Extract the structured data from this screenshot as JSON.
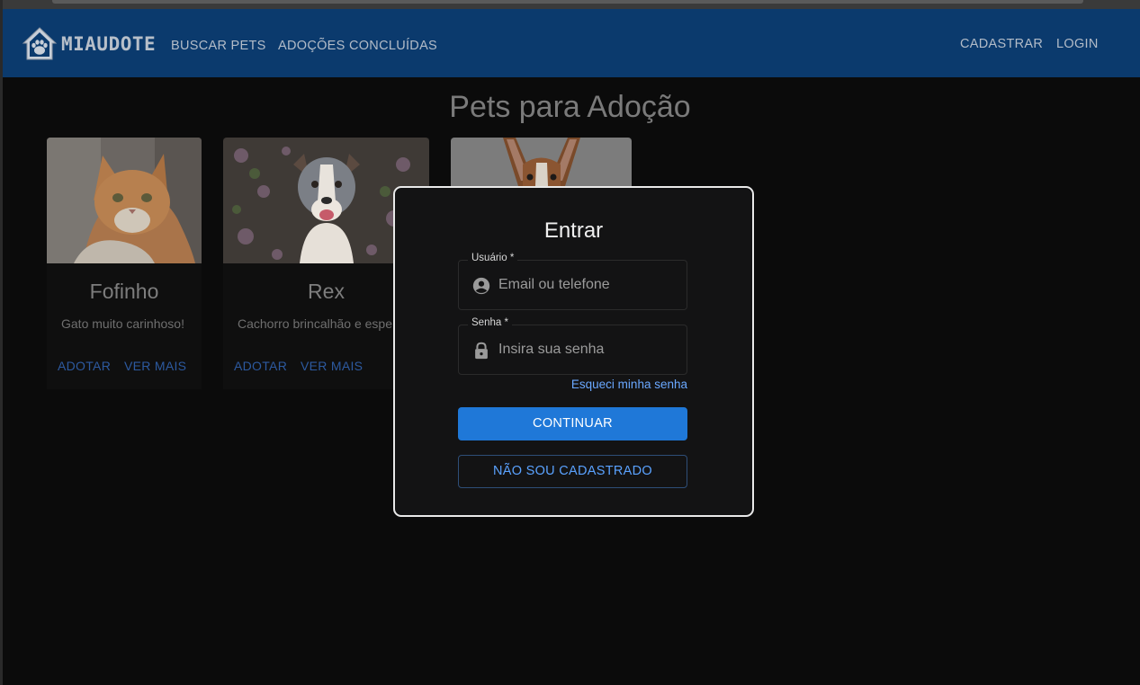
{
  "app": {
    "brand": "MIAUDOTE",
    "nav_left": [
      "BUSCAR PETS",
      "ADOÇÕES CONCLUÍDAS"
    ],
    "nav_right": [
      "CADASTRAR",
      "LOGIN"
    ]
  },
  "page": {
    "title": "Pets para Adoção"
  },
  "pets": [
    {
      "name": "Fofinho",
      "description": "Gato muito carinhoso!",
      "adopt_label": "ADOTAR",
      "more_label": "VER MAIS"
    },
    {
      "name": "Rex",
      "description": "Cachorro brincalhão e espe",
      "adopt_label": "ADOTAR",
      "more_label": "VER MAIS"
    }
  ],
  "login_modal": {
    "title": "Entrar",
    "username_label": "Usuário *",
    "username_placeholder": "Email ou telefone",
    "password_label": "Senha *",
    "password_placeholder": "Insira sua senha",
    "forgot_link": "Esqueci minha senha",
    "continue_button": "CONTINUAR",
    "register_button": "NÃO SOU CADASTRADO"
  },
  "colors": {
    "appbar": "#0b3a6d",
    "primary": "#1f78d8",
    "link": "#6aa8ff",
    "background": "#0b0b0b"
  },
  "icons": [
    "house-paw-logo-icon",
    "account-circle-icon",
    "lock-icon"
  ]
}
